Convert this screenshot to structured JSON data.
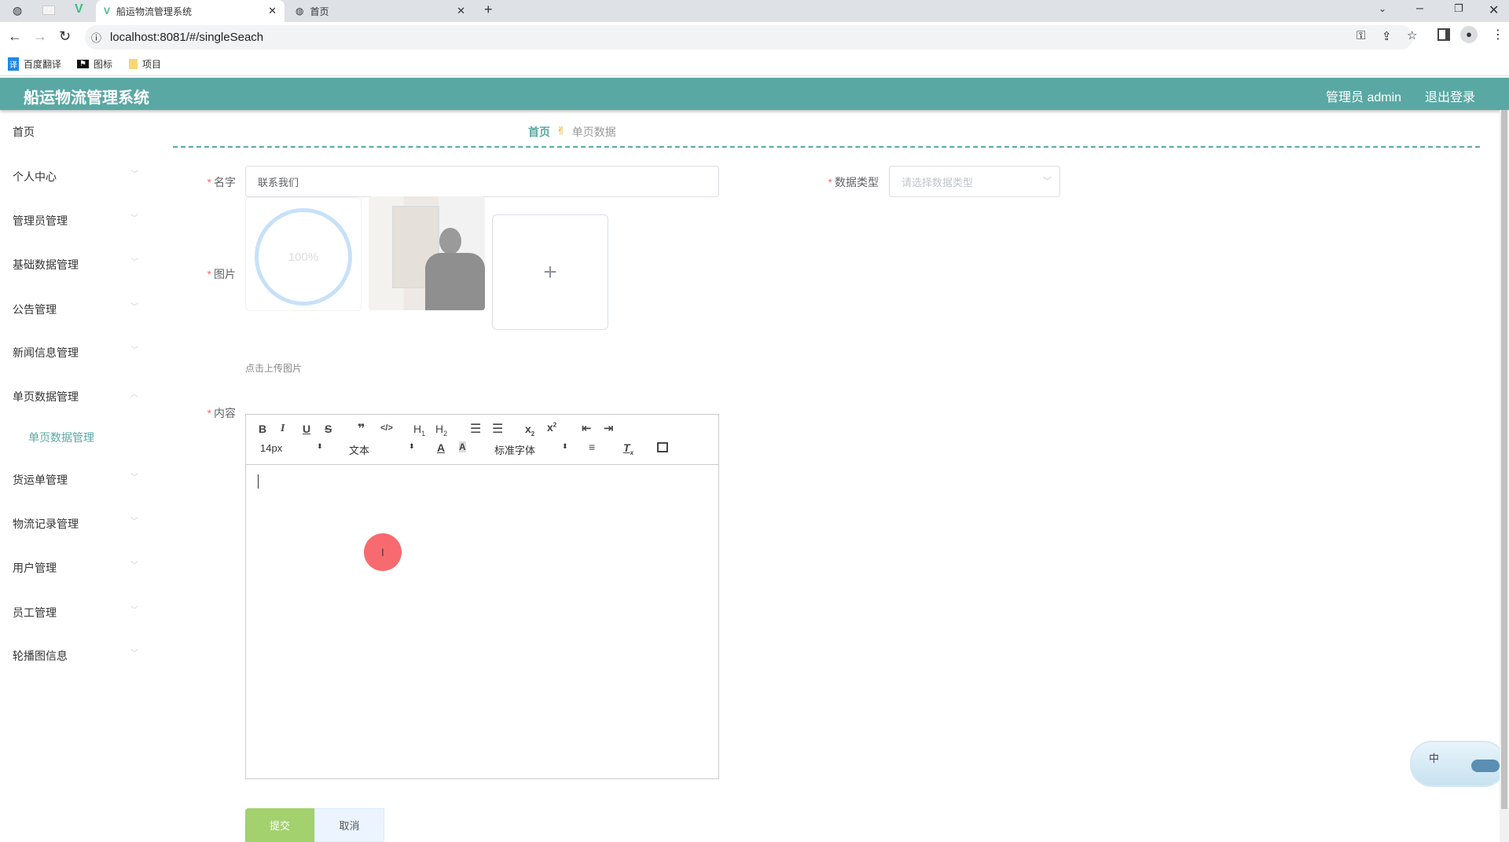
{
  "browser": {
    "tabs": [
      {
        "title": "船运物流管理系统",
        "active": true
      },
      {
        "title": "首页",
        "active": false
      }
    ],
    "url": "localhost:8081/#/singleSeach",
    "bookmarks": [
      "百度翻译",
      "图标",
      "项目"
    ]
  },
  "header": {
    "title": "船运物流管理系统",
    "user": "管理员 admin",
    "logout": "退出登录",
    "color": "#5aa8a4"
  },
  "sidebar": {
    "items": [
      {
        "label": "首页"
      },
      {
        "label": "个人中心"
      },
      {
        "label": "管理员管理"
      },
      {
        "label": "基础数据管理"
      },
      {
        "label": "公告管理"
      },
      {
        "label": "新闻信息管理"
      },
      {
        "label": "单页数据管理"
      },
      {
        "label": "单页数据管理"
      },
      {
        "label": "货运单管理"
      },
      {
        "label": "物流记录管理"
      },
      {
        "label": "用户管理"
      },
      {
        "label": "员工管理"
      },
      {
        "label": "轮播图信息"
      }
    ]
  },
  "breadcrumb": {
    "home": "首页",
    "current": "单页数据"
  },
  "form": {
    "name_label": "名字",
    "name_value": "联系我们",
    "type_label": "数据类型",
    "type_placeholder": "请选择数据类型",
    "image_label": "图片",
    "upload_progress": "100%",
    "upload_hint": "点击上传图片",
    "content_label": "内容",
    "editor": {
      "size": "14px",
      "header": "文本",
      "font": "标准字体"
    },
    "submit": "提交",
    "cancel": "取消"
  },
  "widget": {
    "label": "中"
  }
}
